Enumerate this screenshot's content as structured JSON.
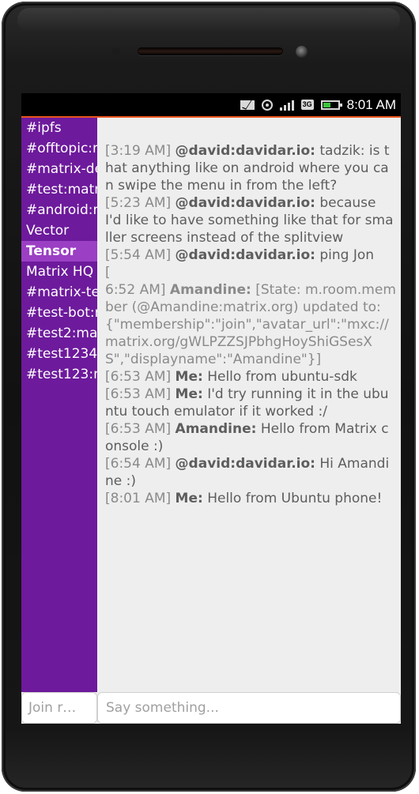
{
  "status": {
    "time": "8:01 AM",
    "network": "3G",
    "icons": [
      "mail-icon",
      "location-icon",
      "signal-icon",
      "network-3g-icon",
      "battery-icon"
    ]
  },
  "colors": {
    "sidebar": "#6d1a9c",
    "selected_room": "#9b3fc4",
    "accent": "#e95420"
  },
  "rooms": [
    "#ipfs",
    "#offtopic:m",
    "#matrix-de",
    "#test:matr",
    "#android:m",
    "Vector",
    "Tensor",
    "Matrix HQ",
    "#matrix-te",
    "#test-bot:m",
    "#test2:ma",
    "#test1234",
    "#test123:m"
  ],
  "selected_room": "Tensor",
  "messages": [
    {
      "time": "[3:19 AM]",
      "sender": "@david:davidar.io:",
      "text": "tadzik: is that anything like on android where you can swipe the menu in from the left?"
    },
    {
      "time": "[5:23 AM]",
      "sender": "@david:davidar.io:",
      "text": "because I'd like to have something like that for smaller screens instead of the splitview"
    },
    {
      "time": "[5:54 AM]",
      "sender": "@david:davidar.io:",
      "text": "ping Jon"
    },
    {
      "time": "[",
      "sender": "",
      "text": ""
    },
    {
      "time": "6:52 AM]",
      "sender": "Amandine:",
      "text": "[State: m.room.member (@Amandine:matrix.org) updated to: {\"membership\":\"join\",\"avatar_url\":\"mxc://matrix.org/gWLPZZSJPbhgHoyShiGSesXS\",\"displayname\":\"Amandine\"}]"
    },
    {
      "time": "[6:53 AM]",
      "sender": "Me:",
      "text": "Hello from ubuntu-sdk"
    },
    {
      "time": "[6:53 AM]",
      "sender": "Me:",
      "text": "I'd try running it in the ubuntu touch emulator if it worked :/"
    },
    {
      "time": "[6:53 AM]",
      "sender": "Amandine:",
      "text": "Hello from Matrix console :)"
    },
    {
      "time": "[6:54 AM]",
      "sender": "@david:davidar.io:",
      "text": "Hi Amandine :)"
    },
    {
      "time": "[8:01 AM]",
      "sender": "Me:",
      "text": "Hello from Ubuntu phone!"
    }
  ],
  "join_placeholder": "Join r…",
  "message_placeholder": "Say something..."
}
